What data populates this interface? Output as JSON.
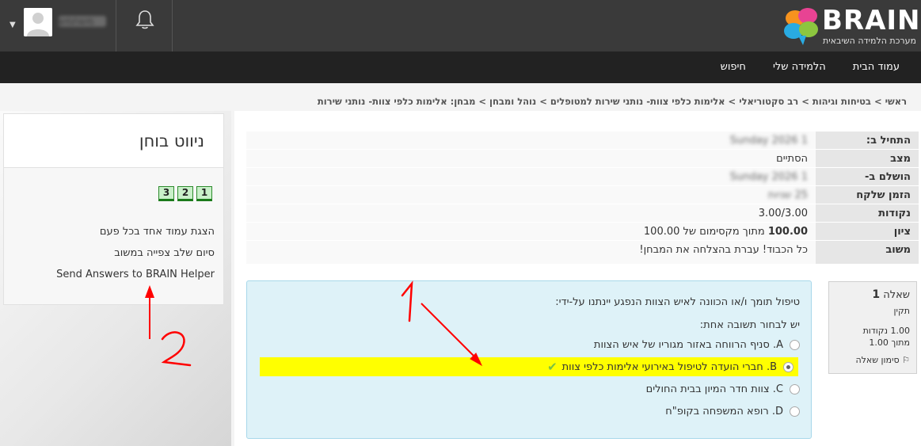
{
  "header": {
    "logo_text": "BRAIN",
    "logo_subtitle": "מערכת הלמידה השיבאית",
    "username": "משתמש"
  },
  "nav": {
    "items": [
      "עמוד הבית",
      "הלמידה שלי",
      "חיפוש"
    ]
  },
  "breadcrumb": "ראשי > בטיחות וגיהות > רב סקטוריאלי > אלימות כלפי צוות- נותני שירות למטופלים > נוהל ומבחן > מבחן: אלימות כלפי צוות- נותני שירות",
  "sidebar": {
    "title": "ניווט בוחן",
    "question_numbers": [
      "1",
      "2",
      "3"
    ],
    "links": [
      "הצגת עמוד אחד בכל פעם",
      "סיום שלב צפייה במשוב",
      "Send Answers to BRAIN Helper"
    ]
  },
  "summary": {
    "rows": [
      {
        "label": "התחיל ב:",
        "value": "1 Sunday 2026"
      },
      {
        "label": "מצב",
        "value": "הסתיים"
      },
      {
        "label": "הושלם ב-",
        "value": "1 Sunday 2026"
      },
      {
        "label": "הזמן שלקח",
        "value": "25 שניות"
      },
      {
        "label": "נקודות",
        "value": "3.00/3.00"
      },
      {
        "label": "ציון",
        "value_bold": "100.00",
        "value": " מתוך מקסימום של 100.00"
      },
      {
        "label": "משוב",
        "value": "כל הכבוד! עברת בהצלחה את המבחן!"
      }
    ]
  },
  "question_info": {
    "label": "שאלה",
    "number": "1",
    "status": "תקין",
    "points": "1.00 נקודות",
    "out_of": "מתוך 1.00",
    "flag": "סימון שאלה"
  },
  "question": {
    "text": "טיפול תומך ו/או הכוונה לאיש הצוות הנפגע יינתנו על-ידי:",
    "prompt": "יש לבחור תשובה אחת:",
    "answers": [
      {
        "letter": "A.",
        "text": "סניף הרווחה באזור מגוריו של איש הצוות",
        "selected": false,
        "correct": false
      },
      {
        "letter": "B.",
        "text": "חברי הועדה לטיפול באירועי אלימות כלפי צוות",
        "selected": true,
        "correct": true
      },
      {
        "letter": "C.",
        "text": "צוות חדר המיון בבית החולים",
        "selected": false,
        "correct": false
      },
      {
        "letter": "D.",
        "text": "רופא המשפחה בקופ\"ח",
        "selected": false,
        "correct": false
      }
    ]
  },
  "annotations": {
    "label_1": "1",
    "label_2": "2"
  },
  "colors": {
    "topbar": "#3a3a3a",
    "navbar": "#222222",
    "highlight": "#ffff00",
    "question_bg": "#def2f8",
    "annotation": "#ff0000"
  }
}
